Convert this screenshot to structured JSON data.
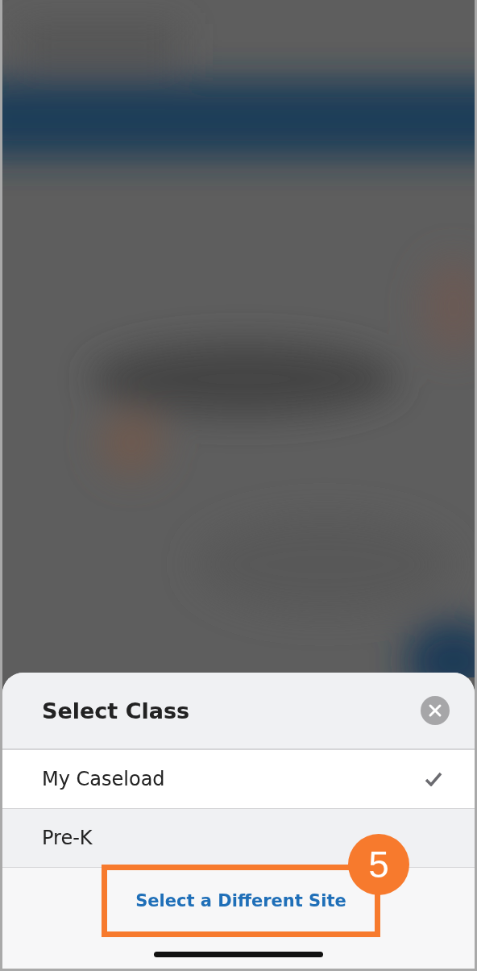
{
  "sheet": {
    "title": "Select Class",
    "items": [
      {
        "label": "My Caseload",
        "selected": true
      },
      {
        "label": "Pre-K",
        "selected": false
      }
    ],
    "footer_link": "Select a Different Site"
  },
  "annotation": {
    "badge": "5"
  }
}
